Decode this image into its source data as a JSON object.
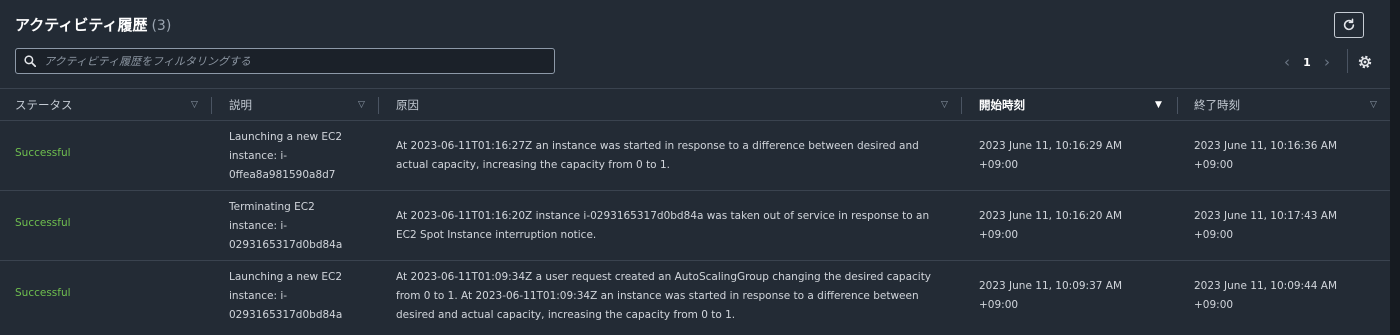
{
  "header": {
    "title": "アクティビティ履歴",
    "count": "(3)"
  },
  "search": {
    "placeholder": "アクティビティ履歴をフィルタリングする"
  },
  "pagination": {
    "current_page": "1",
    "prev": "‹",
    "next": "›"
  },
  "columns": [
    {
      "label": "ステータス",
      "sort": "▽"
    },
    {
      "label": "説明",
      "sort": "▽"
    },
    {
      "label": "原因",
      "sort": "▽"
    },
    {
      "label": "開始時刻",
      "sort": "▼"
    },
    {
      "label": "終了時刻",
      "sort": "▽"
    }
  ],
  "rows": [
    {
      "status": "Successful",
      "description": [
        "Launching a new EC2",
        "instance: i-",
        "0ffea8a981590a8d7"
      ],
      "cause": [
        "At 2023-06-11T01:16:27Z an instance was started in response to a difference between desired and",
        "actual capacity, increasing the capacity from 0 to 1."
      ],
      "start": [
        "2023 June 11, 10:16:29 AM",
        "+09:00"
      ],
      "end": [
        "2023 June 11, 10:16:36 AM",
        "+09:00"
      ]
    },
    {
      "status": "Successful",
      "description": [
        "Terminating EC2",
        "instance: i-",
        "0293165317d0bd84a"
      ],
      "cause": [
        "At 2023-06-11T01:16:20Z instance i-0293165317d0bd84a was taken out of service in response to an",
        "EC2 Spot Instance interruption notice."
      ],
      "start": [
        "2023 June 11, 10:16:20 AM",
        "+09:00"
      ],
      "end": [
        "2023 June 11, 10:17:43 AM",
        "+09:00"
      ]
    },
    {
      "status": "Successful",
      "description": [
        "Launching a new EC2",
        "instance: i-",
        "0293165317d0bd84a"
      ],
      "cause": [
        "At 2023-06-11T01:09:34Z a user request created an AutoScalingGroup changing the desired capacity",
        "from 0 to 1. At 2023-06-11T01:09:34Z an instance was started in response to a difference between",
        "desired and actual capacity, increasing the capacity from 0 to 1."
      ],
      "start": [
        "2023 June 11, 10:09:37 AM",
        "+09:00"
      ],
      "end": [
        "2023 June 11, 10:09:44 AM",
        "+09:00"
      ]
    }
  ],
  "colors": {
    "background": "#232b35",
    "success": "#6fbf4f",
    "border": "#3a434f"
  },
  "icons": {
    "refresh": "refresh-icon",
    "search": "search-icon",
    "settings": "gear-icon"
  }
}
